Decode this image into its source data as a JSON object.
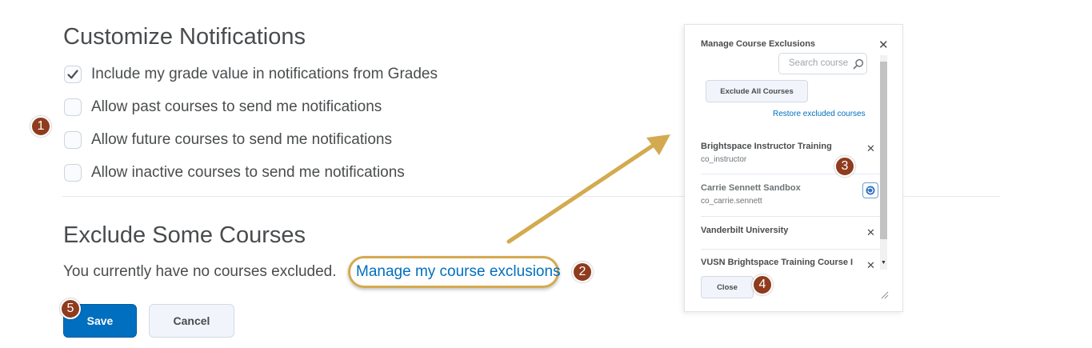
{
  "notifications": {
    "title": "Customize Notifications",
    "options": [
      {
        "label": "Include my grade value in notifications from Grades",
        "checked": true
      },
      {
        "label": "Allow past courses to send me notifications",
        "checked": false
      },
      {
        "label": "Allow future courses to send me notifications",
        "checked": false
      },
      {
        "label": "Allow inactive courses to send me notifications",
        "checked": false
      }
    ]
  },
  "exclusions": {
    "title": "Exclude Some Courses",
    "status_text": "You currently have no courses excluded.",
    "manage_link": "Manage my course exclusions"
  },
  "actions": {
    "save_label": "Save",
    "cancel_label": "Cancel"
  },
  "dialog": {
    "title": "Manage Course Exclusions",
    "search_placeholder": "Search course",
    "exclude_all_label": "Exclude All Courses",
    "restore_link": "Restore excluded courses",
    "courses": [
      {
        "name": "Brightspace Instructor Training",
        "code": "co_instructor",
        "state": "excludable"
      },
      {
        "name": "Carrie Sennett Sandbox",
        "code": "co_carrie.sennett",
        "state": "restorable"
      },
      {
        "name": "Vanderbilt University",
        "code": "",
        "state": "excludable"
      },
      {
        "name": "VUSN Brightspace Training Course I",
        "code": "",
        "state": "excludable"
      }
    ],
    "close_label": "Close"
  },
  "callouts": [
    "1",
    "2",
    "3",
    "4",
    "5"
  ],
  "colors": {
    "accent": "#006fbf",
    "badge": "#8f3b1e",
    "highlight": "#d4aa50",
    "text": "#494c4e"
  },
  "icons": {
    "check": "check-icon",
    "search": "search-icon",
    "close": "close-icon",
    "restore": "restore-icon",
    "resize": "resize-grip-icon",
    "arrow": "arrow-annotation"
  }
}
